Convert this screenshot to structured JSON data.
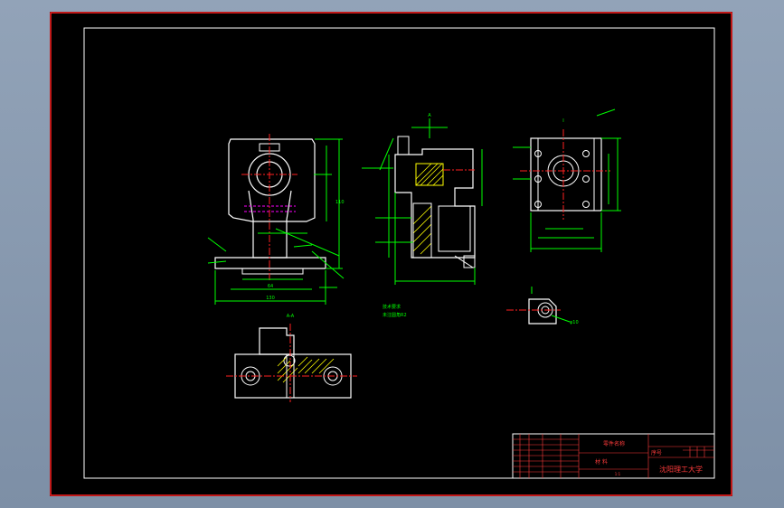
{
  "title_block": {
    "part_name": "零件名称",
    "material": "材 料",
    "seq_label": "序号",
    "university": "沈阳理工大学",
    "scale": "1:1"
  },
  "notes": {
    "tech_req": "技术要求",
    "tech_req_detail": "未注圆角R2"
  },
  "section_labels": {
    "view_a": "A",
    "section_aa": "A-A",
    "detail": "I"
  },
  "dimensions": {
    "width_total": "130",
    "height_total": "110",
    "width_inner": "64",
    "bore": "φ32",
    "side_a": "40",
    "side_b": "65",
    "hole": "φ10"
  },
  "colors": {
    "outline": "#ffffff",
    "dimension": "#00ff00",
    "center": "#ff0000",
    "hatch": "#ffff00",
    "hidden": "#ff00ff",
    "frame": "#ffffff",
    "sheet_border": "#ff0000"
  }
}
